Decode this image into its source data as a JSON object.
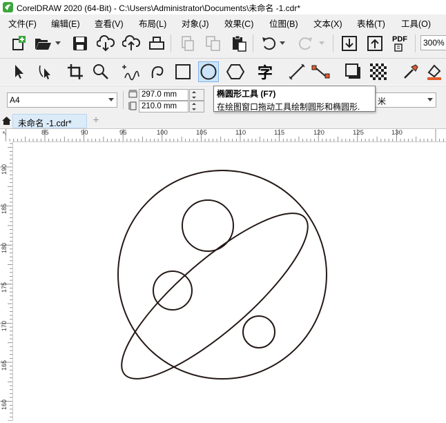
{
  "window": {
    "title": "CorelDRAW 2020 (64-Bit) - C:\\Users\\Administrator\\Documents\\未命名 -1.cdr*"
  },
  "menu": [
    {
      "label": "文件(F)"
    },
    {
      "label": "编辑(E)"
    },
    {
      "label": "查看(V)"
    },
    {
      "label": "布局(L)"
    },
    {
      "label": "对象(J)"
    },
    {
      "label": "效果(C)"
    },
    {
      "label": "位图(B)"
    },
    {
      "label": "文本(X)"
    },
    {
      "label": "表格(T)"
    },
    {
      "label": "工具(O)"
    }
  ],
  "toolbar": {
    "zoom_value": "300%",
    "pdf_label": "PDF"
  },
  "toolbox": {
    "active_tool": "ellipse-tool",
    "text_tool_glyph": "字"
  },
  "property_bar": {
    "paper_size": "A4",
    "width_value": "297.0 mm",
    "height_value": "210.0 mm",
    "units_visible": "米"
  },
  "tooltip": {
    "title": "椭圆形工具 (F7)",
    "description": "在绘图窗口拖动工具绘制圆形和椭圆形."
  },
  "document_tab": {
    "label": "未命名 -1.cdr*",
    "add_symbol": "+"
  },
  "ruler": {
    "corner_symbol": "↖",
    "horizontal_labels": [
      "85",
      "90",
      "95",
      "100",
      "105",
      "110",
      "115",
      "120",
      "125",
      "130"
    ],
    "vertical_labels": [
      "190",
      "185",
      "180",
      "175",
      "170",
      "165",
      "160"
    ]
  },
  "colors": {
    "accent": "#3ba63c",
    "active_tool_bg": "#cce4f7",
    "chrome_bg": "#f0f0f0"
  },
  "drawing": {
    "shapes": [
      "large-circle",
      "tilted-ellipse",
      "small-circle-top",
      "small-circle-left",
      "small-circle-bottom-right"
    ]
  }
}
